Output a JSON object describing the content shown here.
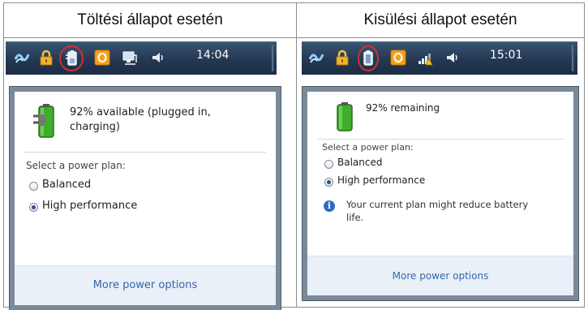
{
  "left": {
    "heading": "Töltési állapot esetén",
    "clock": "14:04",
    "status_line1": "92% available (plugged in,",
    "status_line2": "charging)",
    "plan_prompt": "Select a power plan:",
    "plans": [
      "Balanced",
      "High performance"
    ],
    "selected_plan": "High performance",
    "more_link": "More power options"
  },
  "right": {
    "heading": "Kisülési állapot esetén",
    "clock": "15:01",
    "status": "92% remaining",
    "plan_prompt": "Select a power plan:",
    "plans": [
      "Balanced",
      "High performance"
    ],
    "selected_plan": "High performance",
    "warning_line1": "Your current plan might reduce battery",
    "warning_line2": "life.",
    "more_link": "More power options"
  },
  "battery_percent": 92,
  "colors": {
    "taskbar": "#243852",
    "footer": "#eaf0f8",
    "link": "#3366aa",
    "highlight_circle": "#d0302f",
    "battery_green": "#3fae2a"
  },
  "icons": [
    "network-icon",
    "lock-icon",
    "battery-plugged-icon",
    "office-icon",
    "network-monitor-icon",
    "volume-icon",
    "signal-warning-icon",
    "battery-icon",
    "info-icon"
  ]
}
